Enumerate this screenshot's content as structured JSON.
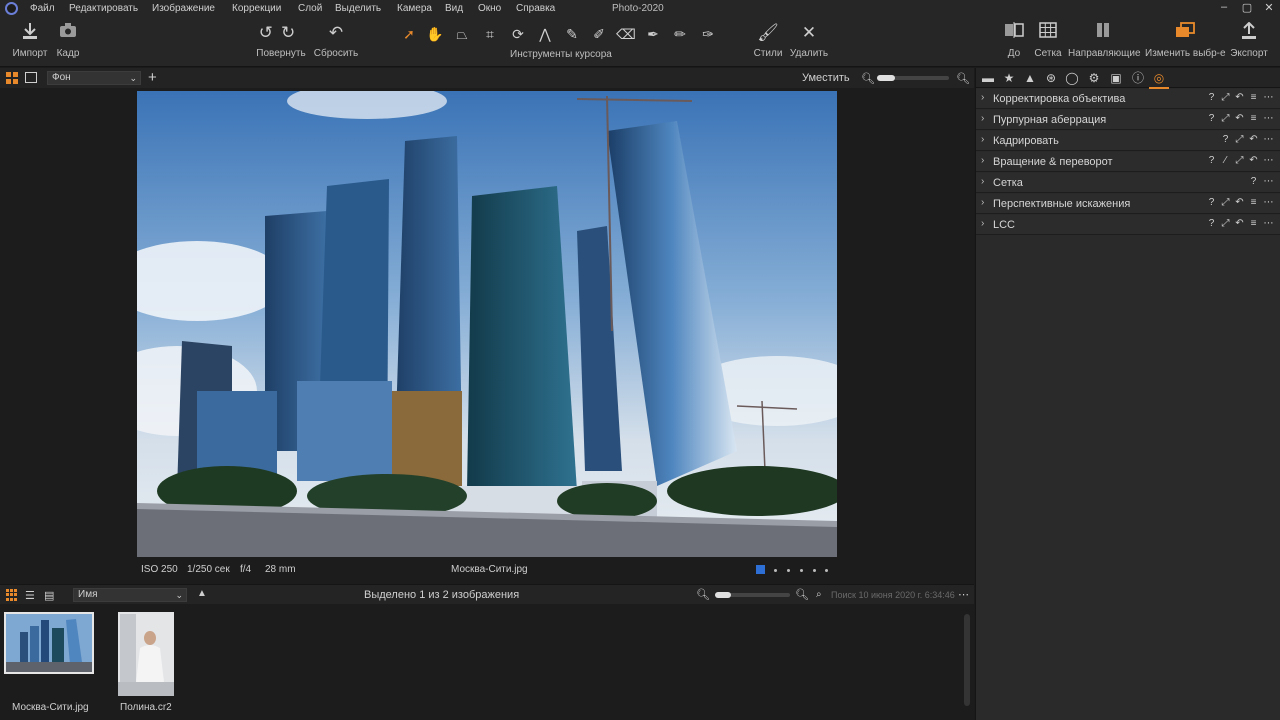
{
  "app": {
    "title": "Photo-2020",
    "menu": [
      "Файл",
      "Редактировать",
      "Изображение",
      "Коррекции",
      "Слой",
      "Выделить",
      "Камера",
      "Вид",
      "Окно",
      "Справка"
    ]
  },
  "toolbar": {
    "import": {
      "label": "Импорт",
      "icon": "import-icon"
    },
    "capture": {
      "label": "Кадр",
      "icon": "camera-icon"
    },
    "rotate": {
      "label": "Повернуть",
      "icon": "rotate-icon"
    },
    "reset": {
      "label": "Сбросить",
      "icon": "reset-icon"
    },
    "cursor_tools_label": "Инструменты курсора",
    "cursor_tools": [
      "select-arrow-icon",
      "hand-icon",
      "keystone-icon",
      "crop-icon",
      "rotate-tool-icon",
      "perspective-icon",
      "brush-icon",
      "eraser-icon",
      "erase-mask-icon",
      "pen-icon",
      "fill-icon",
      "gradient-icon"
    ],
    "styles": {
      "label": "Стили",
      "icon": "brush-icon"
    },
    "delete": {
      "label": "Удалить",
      "icon": "close-icon"
    },
    "before": {
      "label": "До",
      "icon": "before-after-icon"
    },
    "grid": {
      "label": "Сетка",
      "icon": "grid-icon"
    },
    "guides": {
      "label": "Направляющие",
      "icon": "guides-icon"
    },
    "change_selection": {
      "label": "Изменить выбр-е",
      "icon": "change-selection-icon"
    },
    "export": {
      "label": "Экспорт",
      "icon": "export-icon"
    }
  },
  "viewer": {
    "background": "Фон",
    "fit": "Уместить",
    "zoom_level": 0.25,
    "iso": "ISO 250",
    "shutter": "1/250 сек",
    "aperture": "f/4",
    "focal": "28 mm",
    "filename": "Москва-Сити.jpg"
  },
  "tool_tabs": [
    "folder-icon",
    "star-icon",
    "exposure-icon",
    "color-icon",
    "details-icon",
    "settings-icon",
    "clipboard-icon",
    "info-icon",
    "lens-icon"
  ],
  "tools": [
    {
      "name": "Корректировка объектива"
    },
    {
      "name": "Пурпурная аберрация"
    },
    {
      "name": "Кадрировать"
    },
    {
      "name": "Вращение & переворот"
    },
    {
      "name": "Сетка"
    },
    {
      "name": "Перспективные искажения"
    },
    {
      "name": "LCC"
    }
  ],
  "browser": {
    "sort": "Имя",
    "selected": "Выделено 1 из 2 изображения",
    "search_placeholder": "Поиск 10 июня 2020 г. 6:34:46",
    "items": [
      {
        "name": "Москва-Сити.jpg"
      },
      {
        "name": "Полина.cr2"
      }
    ]
  },
  "colors": {
    "accent": "#e88a2c",
    "background": "#1b1b1b",
    "panel": "#2a2a2a",
    "selection_blue": "#2e6fd6"
  }
}
